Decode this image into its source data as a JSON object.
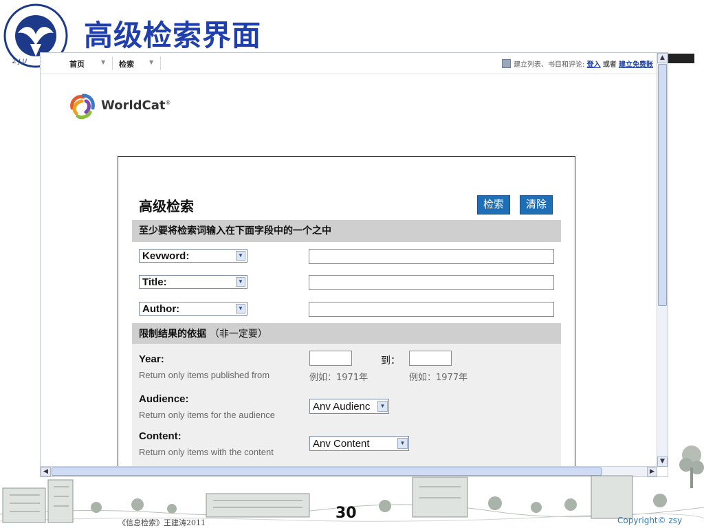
{
  "slide": {
    "title": "高级检索界面",
    "footer_credit": "《信息检索》王建涛2011",
    "page_number": "30",
    "copyright": "Copyright© zsy"
  },
  "browser": {
    "nav": {
      "home": "首页",
      "search": "检索"
    },
    "account": {
      "prefix": "建立列表、书目和评论:",
      "login": "登入",
      "or": "或者",
      "signup": "建立免费账"
    },
    "brand": "WorldCat"
  },
  "advanced_search": {
    "title": "高级检索",
    "search_button": "检索",
    "clear_button": "清除",
    "section_required": "至少要将检索词输入在下面字段中的一个之中",
    "fields": [
      {
        "selected": "Kevword:",
        "value": ""
      },
      {
        "selected": "Title:",
        "value": ""
      },
      {
        "selected": "Author:",
        "value": ""
      }
    ],
    "section_limits": "限制结果的依据",
    "section_limits_note": "（非一定要）",
    "year": {
      "label": "Year:",
      "hint": "Return only items published from",
      "to": "到：",
      "from_example": "例如：1971年",
      "to_example": "例如：1977年"
    },
    "audience": {
      "label": "Audience:",
      "hint": "Return only items for the audience",
      "selected": "Anv Audienc"
    },
    "content": {
      "label": "Content:",
      "hint": "Return only items with the content",
      "selected": "Anv Content"
    }
  },
  "colors": {
    "slide_title": "#1f3fae",
    "button_blue": "#1f6fb6",
    "section_gray": "#cfcfcf",
    "link_blue": "#1a3fa0"
  },
  "icons": [
    "university-seal-icon",
    "worldcat-logo-icon",
    "dropdown-arrow-icon",
    "scroll-up-icon",
    "scroll-down-icon",
    "scroll-left-icon",
    "scroll-right-icon"
  ]
}
